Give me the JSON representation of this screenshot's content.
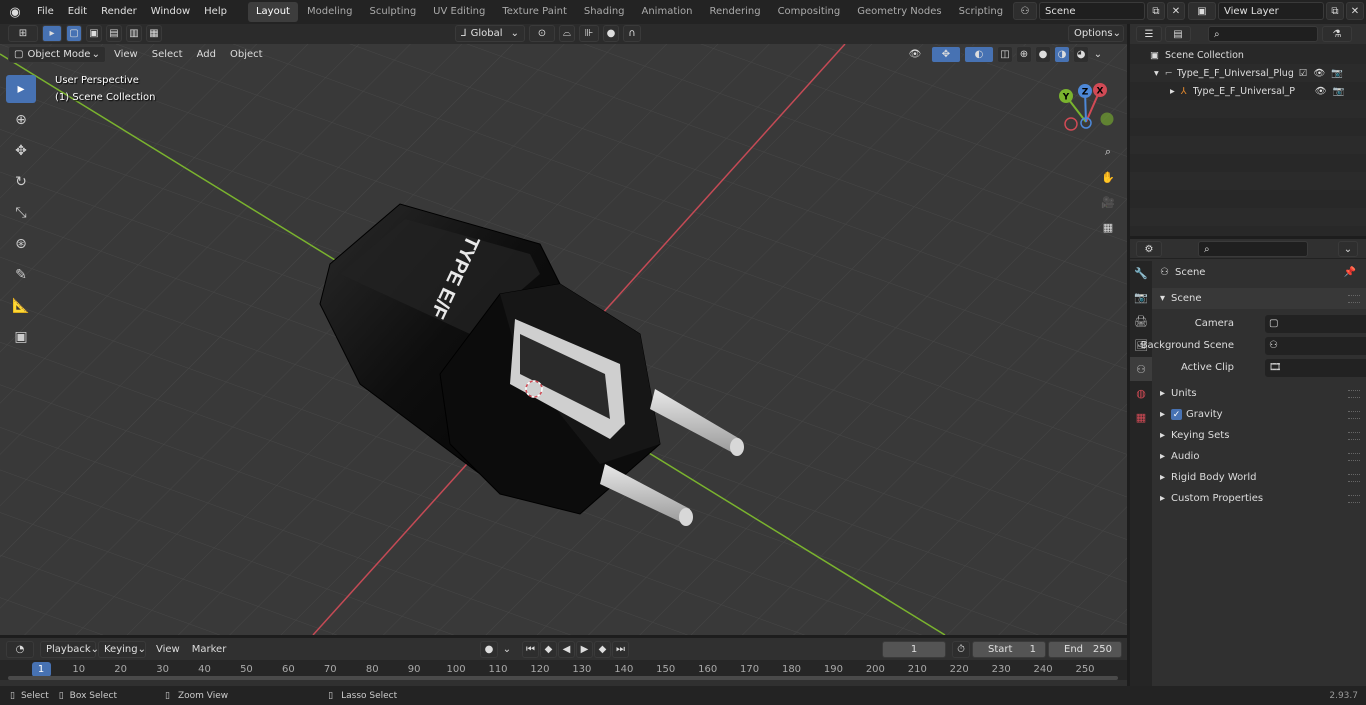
{
  "topbar": {
    "menus": [
      "File",
      "Edit",
      "Render",
      "Window",
      "Help"
    ],
    "workspaces": [
      "Layout",
      "Modeling",
      "Sculpting",
      "UV Editing",
      "Texture Paint",
      "Shading",
      "Animation",
      "Rendering",
      "Compositing",
      "Geometry Nodes",
      "Scripting"
    ],
    "active_workspace": "Layout",
    "add_tab": "+",
    "scene_name": "Scene",
    "view_layer": "View Layer"
  },
  "viewport_header": {
    "mode": "Object Mode",
    "menus": [
      "View",
      "Select",
      "Add",
      "Object"
    ],
    "transform_orientation": "Global",
    "options": "Options"
  },
  "viewport": {
    "perspective_label": "User Perspective",
    "collection_label": "(1) Scene Collection",
    "gizmo": {
      "x": "X",
      "y": "Y",
      "z": "Z"
    },
    "plug_text": "TYPE E/F"
  },
  "outliner": {
    "search_placeholder": "",
    "rows": [
      {
        "label": "Scene Collection"
      },
      {
        "label": "Type_E_F_Universal_Plug_Ada"
      },
      {
        "label": "Type_E_F_Universal_Plug"
      }
    ]
  },
  "properties": {
    "header_title": "Scene",
    "section_title": "Scene",
    "fields": [
      {
        "label": "Camera",
        "value": ""
      },
      {
        "label": "Background Scene",
        "value": ""
      },
      {
        "label": "Active Clip",
        "value": ""
      }
    ],
    "panels": [
      "Units",
      "Gravity",
      "Keying Sets",
      "Audio",
      "Rigid Body World",
      "Custom Properties"
    ],
    "gravity_checked": true
  },
  "timeline": {
    "menus": [
      "Playback",
      "Keying",
      "View",
      "Marker"
    ],
    "current_frame": "1",
    "start_label": "Start",
    "start": "1",
    "end_label": "End",
    "end": "250",
    "ticks": [
      "1",
      "10",
      "20",
      "30",
      "40",
      "50",
      "60",
      "70",
      "80",
      "90",
      "100",
      "110",
      "120",
      "130",
      "140",
      "150",
      "160",
      "170",
      "180",
      "190",
      "200",
      "210",
      "220",
      "230",
      "240",
      "250"
    ]
  },
  "statusbar": {
    "select": "Select",
    "box_select": "Box Select",
    "zoom_view": "Zoom View",
    "lasso_select": "Lasso Select",
    "version": "2.93.7"
  },
  "colors": {
    "accent": "#4772b3",
    "x_axis": "#d14a55",
    "y_axis": "#7ab32e",
    "z_axis": "#4d88d8"
  }
}
